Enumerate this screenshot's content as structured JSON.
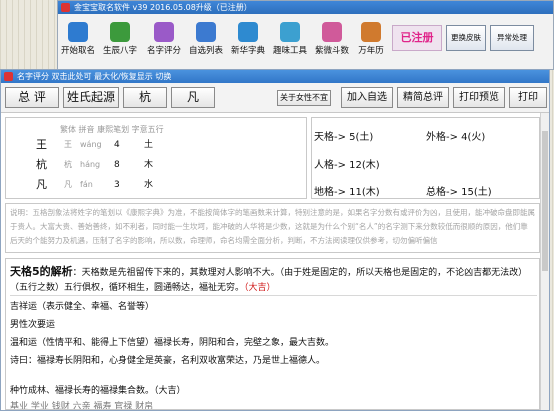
{
  "main_window": {
    "title": "金宝宝取名软件 v39  2016.05.08升级（已注册）",
    "toolbar": [
      {
        "label": "开始取名",
        "icon": "start-icon",
        "color": "#2e7bd0"
      },
      {
        "label": "生辰八字",
        "icon": "zodiac-icon",
        "color": "#3c9a3c"
      },
      {
        "label": "名字评分",
        "icon": "score-icon",
        "color": "#9a5ac8"
      },
      {
        "label": "自选列表",
        "icon": "list-icon",
        "color": "#3c7ad0"
      },
      {
        "label": "新华字典",
        "icon": "dictionary-icon",
        "color": "#2e8ad0"
      },
      {
        "label": "趣味工具",
        "icon": "tools-icon",
        "color": "#3ca0d0"
      },
      {
        "label": "紫微斗数",
        "icon": "astrology-icon",
        "color": "#d05a9a"
      },
      {
        "label": "万年历",
        "icon": "calendar-icon",
        "color": "#d07a2e"
      }
    ],
    "registered_label": "已注册",
    "change_skin_label": "更换皮肤",
    "error_label": "异常处理"
  },
  "child_window": {
    "title": "名字评分  双击此处可 最大化/恢复显示  切换",
    "buttons": {
      "zongping": "总 评",
      "origin": "姓氏起源",
      "char1": "杭",
      "char2": "凡",
      "female": "关于女性不宜",
      "add": "加入自选",
      "precise": "精简总评",
      "preview": "打印预览",
      "print": "打印"
    }
  },
  "char_table": {
    "header": "繁体 拼音 康熙笔划 字意五行",
    "rows": [
      {
        "char": "王",
        "trad": "王",
        "pinyin": "wáng",
        "strokes": "4",
        "element": "土"
      },
      {
        "char": "杭",
        "trad": "杭",
        "pinyin": "háng",
        "strokes": "8",
        "element": "木"
      },
      {
        "char": "凡",
        "trad": "凡",
        "pinyin": "fán",
        "strokes": "3",
        "element": "水"
      }
    ]
  },
  "grids": {
    "tian": "天格-> 5(土)",
    "ren": "人格-> 12(木)",
    "di": "地格-> 11(木)",
    "wai": "外格-> 4(火)",
    "zong": "总格-> 15(土)"
  },
  "note": "说明：五格剖象法将姓字的笔划以《康熙字典》为准，不能按简体字的笔画数来计算，特别注意的是，如果名字分数有或评价为凶，且使用，能冲破命盘即能属于贵人。大富大贵、善始善终，如不利者，同时能一生坎坷，能冲破的人华将是少数，这就是为什么个别“名人”的名字测下来分数较低而很顺的原因，他们靠后天的个能努力及机遇，压制了名字的影响，所以数，命理师，命名均需全面分析，判断，不方法阅读理仅供参考，切勿偏听偏信",
  "analysis": {
    "heading": "天格5的解析",
    "heading_rest": "：天格数是先祖留传下来的，其数理对人影响不大。（由于姓是固定的，所以天格也是固定的，不论凶吉都无法改）",
    "sub": "（五行之数）五行俱权，循环相生，圆通畅达，福祉无穷。",
    "sub_tag": "（大吉）",
    "lines": [
      "吉祥运（表示健全、幸福、名誉等）",
      "男性次要运",
      "温和运（性情平和、能得上下信望）福禄长寿，阴阳和合，完壁之象，最大吉数。",
      "诗曰：福禄寿长阴阳和，心身健全是英豪，名利双收富荣达，乃是世上福德人。",
      "",
      "种竹成林、福禄长寿的福禄集合数。（大吉）",
      "基业   学业   钱财   六亲   福寿   官禄   财帛"
    ]
  }
}
